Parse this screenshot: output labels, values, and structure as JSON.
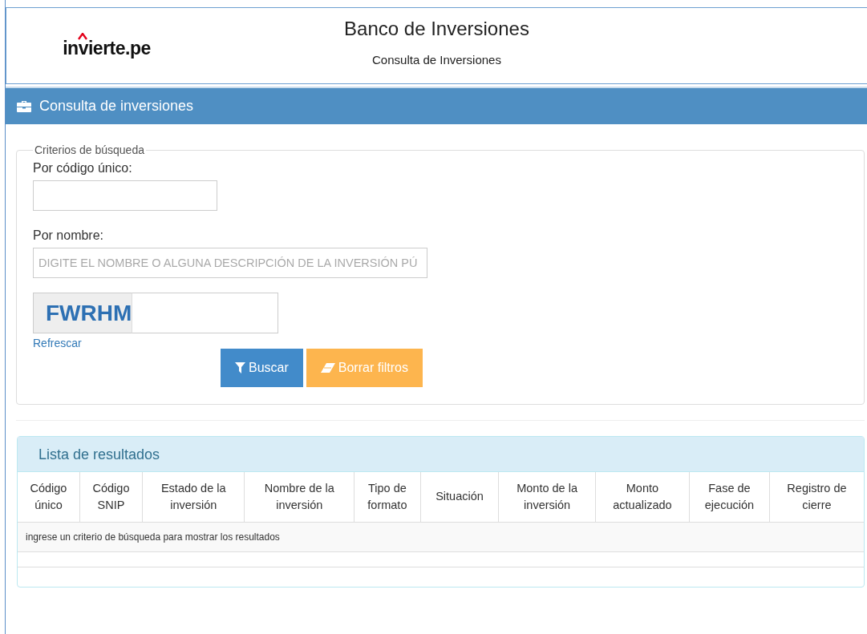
{
  "header": {
    "logo": "invierte.pe",
    "title": "Banco de Inversiones",
    "subtitle": "Consulta de Inversiones"
  },
  "panel_title": "Consulta de inversiones",
  "search": {
    "legend": "Criterios de búsqueda",
    "code_label": "Por código único:",
    "name_label": "Por nombre:",
    "name_placeholder": "DIGITE EL NOMBRE O ALGUNA DESCRIPCIÓN DE LA INVERSIÓN PÚ",
    "captcha": "FWRHM",
    "refresh_link": "Refrescar",
    "buttons": [
      {
        "kind": "primary",
        "label": "Buscar"
      },
      {
        "kind": "warning",
        "label": "Borrar filtros"
      }
    ]
  },
  "results": {
    "title": "Lista de resultados",
    "columns": [
      [
        "Código",
        "único"
      ],
      [
        "Código",
        "SNIP"
      ],
      [
        "Estado de la",
        "inversión"
      ],
      [
        "Nombre de la",
        "inversión"
      ],
      [
        "Tipo de",
        "formato"
      ],
      [
        "Situación"
      ],
      [
        "Monto de la",
        "inversión"
      ],
      [
        "Monto",
        "actualizado"
      ],
      [
        "Fase de",
        "ejecución"
      ],
      [
        "Registro de",
        "cierre"
      ]
    ],
    "empty_message": "ingrese un criterio de búsqueda para mostrar los resultados"
  }
}
